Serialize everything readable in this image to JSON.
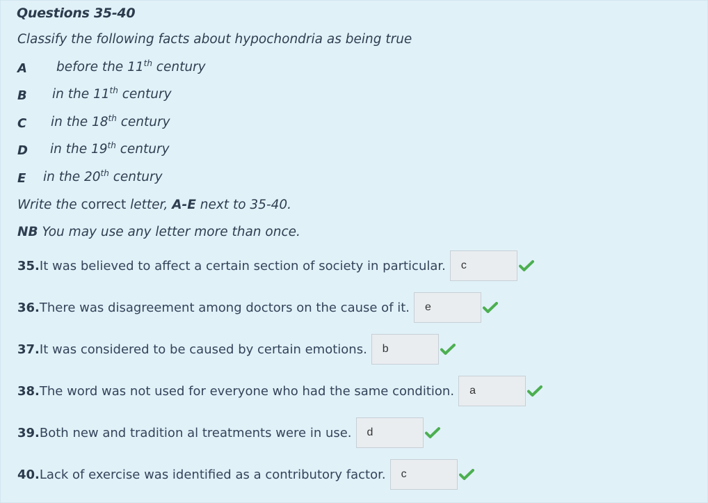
{
  "header": {
    "title": "Questions 35-40",
    "instruction": "Classify the following facts about hypochondria as being true"
  },
  "options": [
    {
      "letter": "A",
      "pre": "before the 11",
      "sup": "th",
      "post": " century"
    },
    {
      "letter": "B",
      "pre": "in the 11",
      "sup": "th",
      "post": " century"
    },
    {
      "letter": "C",
      "pre": "in the 18",
      "sup": "th",
      "post": " century"
    },
    {
      "letter": "D",
      "pre": "in the 19",
      "sup": "th",
      "post": " century"
    },
    {
      "letter": "E",
      "pre": "in the 20",
      "sup": "th",
      "post": " century"
    }
  ],
  "write_line": {
    "part1": "Write the ",
    "part2": "correct",
    "part3": " letter, ",
    "range": "A-E",
    "part4": " next to 35-40."
  },
  "nb_line": {
    "nb": "NB",
    "text": " You may use any letter more than once."
  },
  "questions": [
    {
      "number": "35.",
      "text": " It  was believed to affect a certain section of society in particular.",
      "answer": "c"
    },
    {
      "number": "36.",
      "text": " There was disagreement among doctors on the cause of it.",
      "answer": "e"
    },
    {
      "number": "37.",
      "text": " It was considered to be caused by certain emotions.",
      "answer": "b"
    },
    {
      "number": "38.",
      "text": " The word  was not used for everyone who had the same condition.",
      "answer": "a"
    },
    {
      "number": "39.",
      "text": " Both new and tradition al treatments were in use.",
      "answer": "d"
    },
    {
      "number": "40.",
      "text": " Lack of exercise was identified as a contributory factor.",
      "answer": "c"
    }
  ],
  "colors": {
    "background": "#e1f1f8",
    "check": "#4caf50"
  },
  "icons": {
    "correct": "check-icon"
  }
}
